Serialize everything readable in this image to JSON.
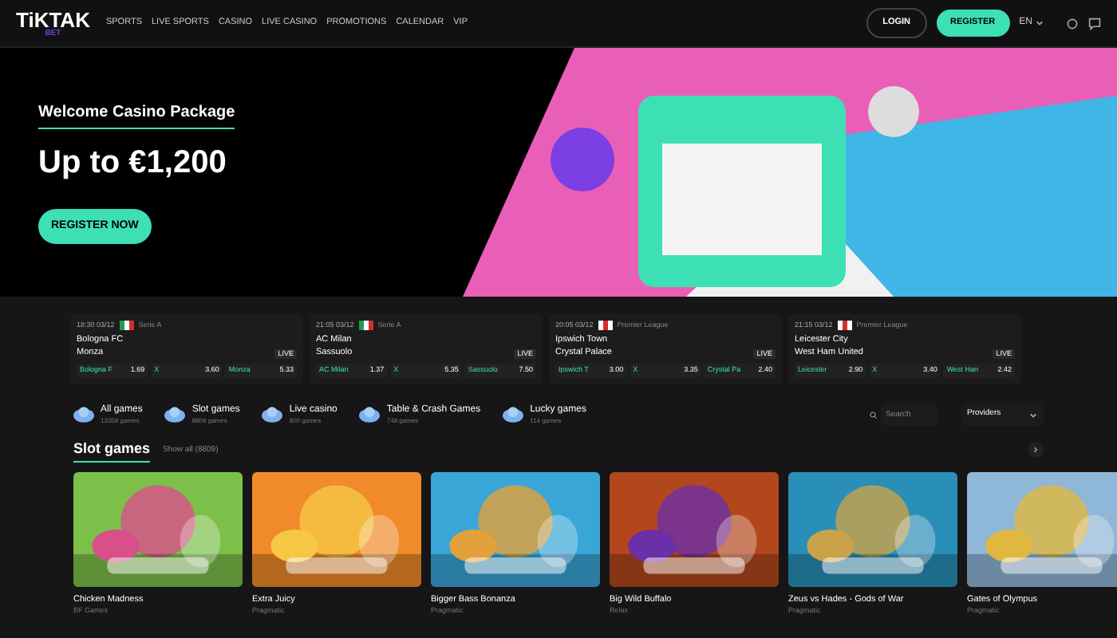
{
  "header": {
    "logo": "TiKTAK",
    "logo_sub": "BET",
    "nav": [
      "SPORTS",
      "LIVE SPORTS",
      "CASINO",
      "LIVE CASINO",
      "PROMOTIONS",
      "CALENDAR",
      "VIP"
    ],
    "login": "LOGIN",
    "register": "REGISTER",
    "language": "EN"
  },
  "hero": {
    "kicker": "Welcome Casino Package",
    "title": "Up to €1,200",
    "button": "REGISTER NOW"
  },
  "matches": [
    {
      "time": "18:30 03/12",
      "league": "Serie A",
      "home": "Bologna FC",
      "away": "Monza",
      "live": "LIVE",
      "odds": [
        {
          "label": "Bologna F",
          "value": "1.69"
        },
        {
          "label": "X",
          "value": "3.60"
        },
        {
          "label": "Monza",
          "value": "5.33"
        }
      ]
    },
    {
      "time": "21:05 03/12",
      "league": "Serie A",
      "home": "AC Milan",
      "away": "Sassuolo",
      "live": "LIVE",
      "odds": [
        {
          "label": "AC Milan",
          "value": "1.37"
        },
        {
          "label": "X",
          "value": "5.35"
        },
        {
          "label": "Sassuolo",
          "value": "7.50"
        }
      ]
    },
    {
      "time": "20:05 03/12",
      "league": "Premier League",
      "home": "Ipswich Town",
      "away": "Crystal Palace",
      "live": "LIVE",
      "odds": [
        {
          "label": "Ipswich T",
          "value": "3.00"
        },
        {
          "label": "X",
          "value": "3.35"
        },
        {
          "label": "Crystal Pa",
          "value": "2.40"
        }
      ]
    },
    {
      "time": "21:15 03/12",
      "league": "Premier League",
      "home": "Leicester City",
      "away": "West Ham United",
      "live": "LIVE",
      "odds": [
        {
          "label": "Leicester",
          "value": "2.90"
        },
        {
          "label": "X",
          "value": "3.40"
        },
        {
          "label": "West Han",
          "value": "2.42"
        }
      ]
    }
  ],
  "categories": [
    {
      "name": "All games",
      "count": "13358 games"
    },
    {
      "name": "Slot games",
      "count": "8809 games"
    },
    {
      "name": "Live casino",
      "count": "800 games"
    },
    {
      "name": "Table & Crash Games",
      "count": "748 games"
    },
    {
      "name": "Lucky games",
      "count": "114 games"
    }
  ],
  "search": {
    "placeholder": "Search"
  },
  "providers": "Providers",
  "section": {
    "title": "Slot games",
    "show_all": "Show all (8809)"
  },
  "games": [
    {
      "name": "Chicken Madness",
      "provider": "BF Games"
    },
    {
      "name": "Extra Juicy",
      "provider": "Pragmatic"
    },
    {
      "name": "Bigger Bass Bonanza",
      "provider": "Pragmatic"
    },
    {
      "name": "Big Wild Buffalo",
      "provider": "Relax"
    },
    {
      "name": "Zeus vs Hades - Gods of War",
      "provider": "Pragmatic"
    },
    {
      "name": "Gates of Olympus",
      "provider": "Pragmatic"
    }
  ]
}
